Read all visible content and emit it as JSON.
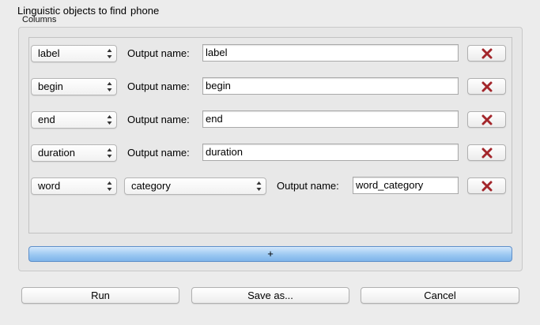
{
  "header": {
    "prefix": "Linguistic objects to find",
    "object_type": "phone"
  },
  "columns_group": {
    "title": "Columns"
  },
  "rows": [
    {
      "attribute": "label",
      "output_label": "Output name:",
      "output_value": "label"
    },
    {
      "attribute": "begin",
      "output_label": "Output name:",
      "output_value": "begin"
    },
    {
      "attribute": "end",
      "output_label": "Output name:",
      "output_value": "end"
    },
    {
      "attribute": "duration",
      "output_label": "Output name:",
      "output_value": "duration"
    },
    {
      "attribute": "word",
      "subattribute": "category",
      "output_label": "Output name:",
      "output_value": "word_category"
    }
  ],
  "icons": {
    "delete": "red-x-icon",
    "select": "updown-arrows-icon"
  },
  "colors": {
    "delete_icon": "#a3262b",
    "add_button": "#8fc0f0"
  },
  "add_button": {
    "label": "+"
  },
  "footer": {
    "run_label": "Run",
    "save_label": "Save as...",
    "cancel_label": "Cancel"
  }
}
